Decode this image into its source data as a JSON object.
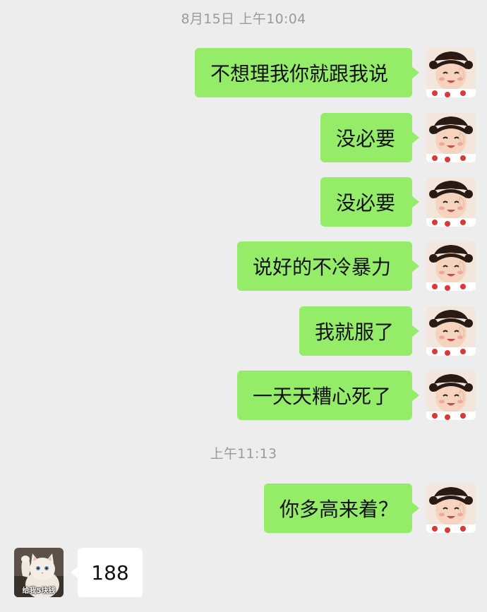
{
  "timestamps": {
    "first": "8月15日 上午10:04",
    "second": "上午11:13"
  },
  "messages": [
    {
      "sender": "me",
      "text": "不想理我你就跟我说"
    },
    {
      "sender": "me",
      "text": "没必要"
    },
    {
      "sender": "me",
      "text": "没必要"
    },
    {
      "sender": "me",
      "text": "说好的不冷暴力"
    },
    {
      "sender": "me",
      "text": "我就服了"
    },
    {
      "sender": "me",
      "text": "一天天糟心死了"
    },
    {
      "sender": "me",
      "text": "你多高来着？"
    },
    {
      "sender": "other",
      "text": "188"
    }
  ],
  "avatars": {
    "me": "girl-avatar-icon",
    "other": "cat-avatar-icon",
    "other_caption": "给我5块钱"
  },
  "colors": {
    "background": "#ededed",
    "my_bubble": "#95ec69",
    "their_bubble": "#ffffff",
    "timestamp": "#9a9a9a"
  }
}
